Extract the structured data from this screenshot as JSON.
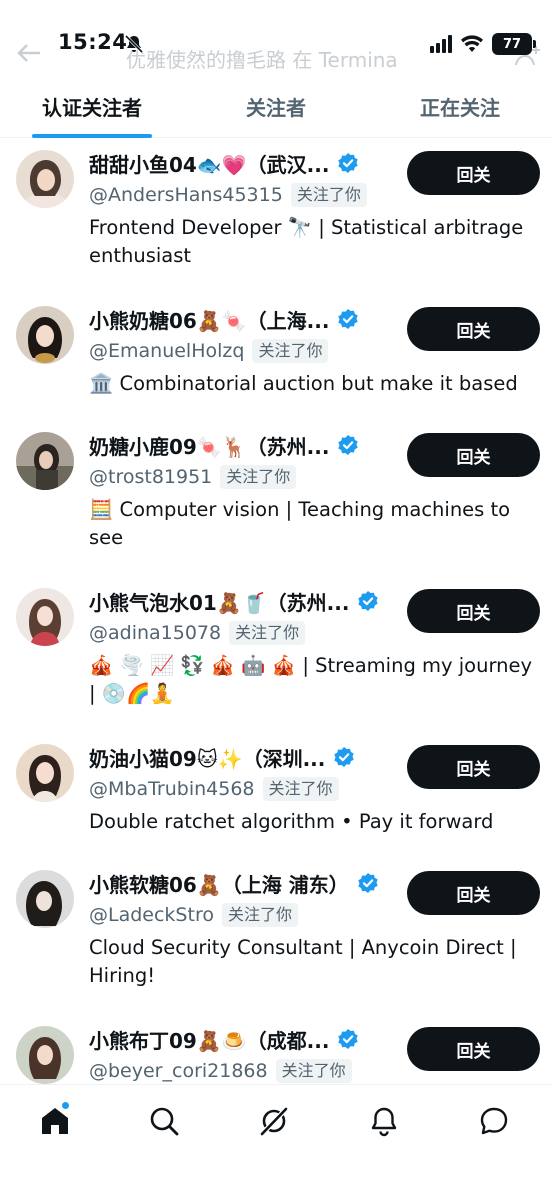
{
  "status_bar": {
    "time": "15:24",
    "battery": "77",
    "faded_title": "优雅使然的撸毛路 在 Termina"
  },
  "tabs": [
    {
      "label": "认证关注者",
      "active": true
    },
    {
      "label": "关注者",
      "active": false
    },
    {
      "label": "正在关注",
      "active": false
    }
  ],
  "follows_you_label": "关注了你",
  "follow_back_label": "回关",
  "users": [
    {
      "name": "甜甜小鱼04🐟💗（武汉...",
      "handle": "@AndersHans45315",
      "bio": "Frontend Developer 🔭 | Statistical arbitrage enthusiast"
    },
    {
      "name": "小熊奶糖06🧸🍬（上海...",
      "handle": "@EmanuelHolzq",
      "bio": "🏛️ Combinatorial auction but make it based"
    },
    {
      "name": "奶糖小鹿09🍬🦌（苏州...",
      "handle": "@trost81951",
      "bio": "🧮 Computer vision | Teaching machines to see"
    },
    {
      "name": "小熊气泡水01🧸🥤（苏州...",
      "handle": "@adina15078",
      "bio": "🎪 🌪️ 📈 💱 🎪 🤖 🎪 | Streaming my journey | 💿🌈🧘"
    },
    {
      "name": "奶油小猫09🐱✨（深圳...",
      "handle": "@MbaTrubin4568",
      "bio": "Double ratchet algorithm • Pay it forward"
    },
    {
      "name": "小熊软糖06🧸（上海 浦东）",
      "handle": "@LadeckStro",
      "bio": "Cloud Security Consultant | Anycoin Direct | Hiring!"
    },
    {
      "name": "小熊布丁09🧸🍮（成都...",
      "handle": "@beyer_cori21868",
      "bio": ""
    }
  ],
  "colors": {
    "accent": "#1d9bf0",
    "text": "#0f1419",
    "secondary": "#536471",
    "button_bg": "#0f1419"
  },
  "icons": [
    "home-icon",
    "search-icon",
    "grok-icon",
    "notifications-icon",
    "messages-icon",
    "verified-badge-icon"
  ]
}
